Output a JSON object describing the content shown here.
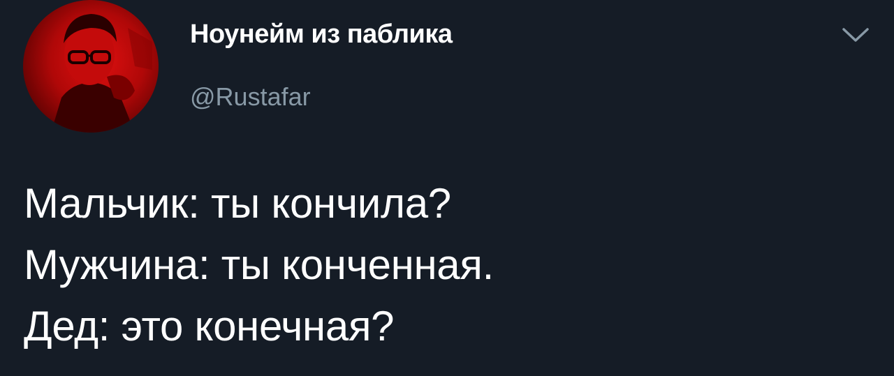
{
  "tweet": {
    "author": {
      "display_name": "Ноунейм из паблика",
      "handle": "@Rustafar",
      "avatar_icon": "user-avatar-photo"
    },
    "menu_icon": "chevron-down-icon",
    "lines": [
      "Мальчик: ты кончила?",
      "Мужчина: ты конченная.",
      "Дед: это конечная?"
    ]
  },
  "colors": {
    "background": "#151c26",
    "text": "#ffffff",
    "secondary_text": "#8899a6",
    "avatar_accent": "#d40c0c"
  }
}
